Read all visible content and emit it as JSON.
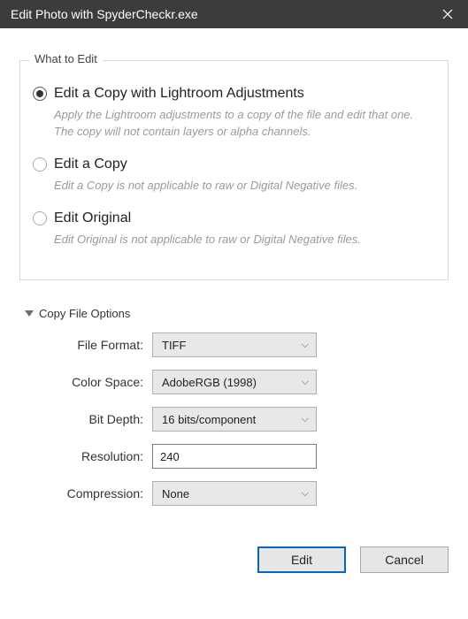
{
  "window": {
    "title": "Edit Photo with SpyderCheckr.exe"
  },
  "whatToEdit": {
    "legend": "What to Edit",
    "options": [
      {
        "label": "Edit a Copy with Lightroom Adjustments",
        "description": "Apply the Lightroom adjustments to a copy of the file and edit that one. The copy will not contain layers or alpha channels.",
        "selected": true
      },
      {
        "label": "Edit a Copy",
        "description": "Edit a Copy is not applicable to raw or Digital Negative files.",
        "selected": false
      },
      {
        "label": "Edit Original",
        "description": "Edit Original is not applicable to raw or Digital Negative files.",
        "selected": false
      }
    ]
  },
  "copyFileOptions": {
    "header": "Copy File Options",
    "fileFormat": {
      "label": "File Format:",
      "value": "TIFF"
    },
    "colorSpace": {
      "label": "Color Space:",
      "value": "AdobeRGB (1998)"
    },
    "bitDepth": {
      "label": "Bit Depth:",
      "value": "16 bits/component"
    },
    "resolution": {
      "label": "Resolution:",
      "value": "240"
    },
    "compression": {
      "label": "Compression:",
      "value": "None"
    }
  },
  "buttons": {
    "edit": "Edit",
    "cancel": "Cancel"
  }
}
